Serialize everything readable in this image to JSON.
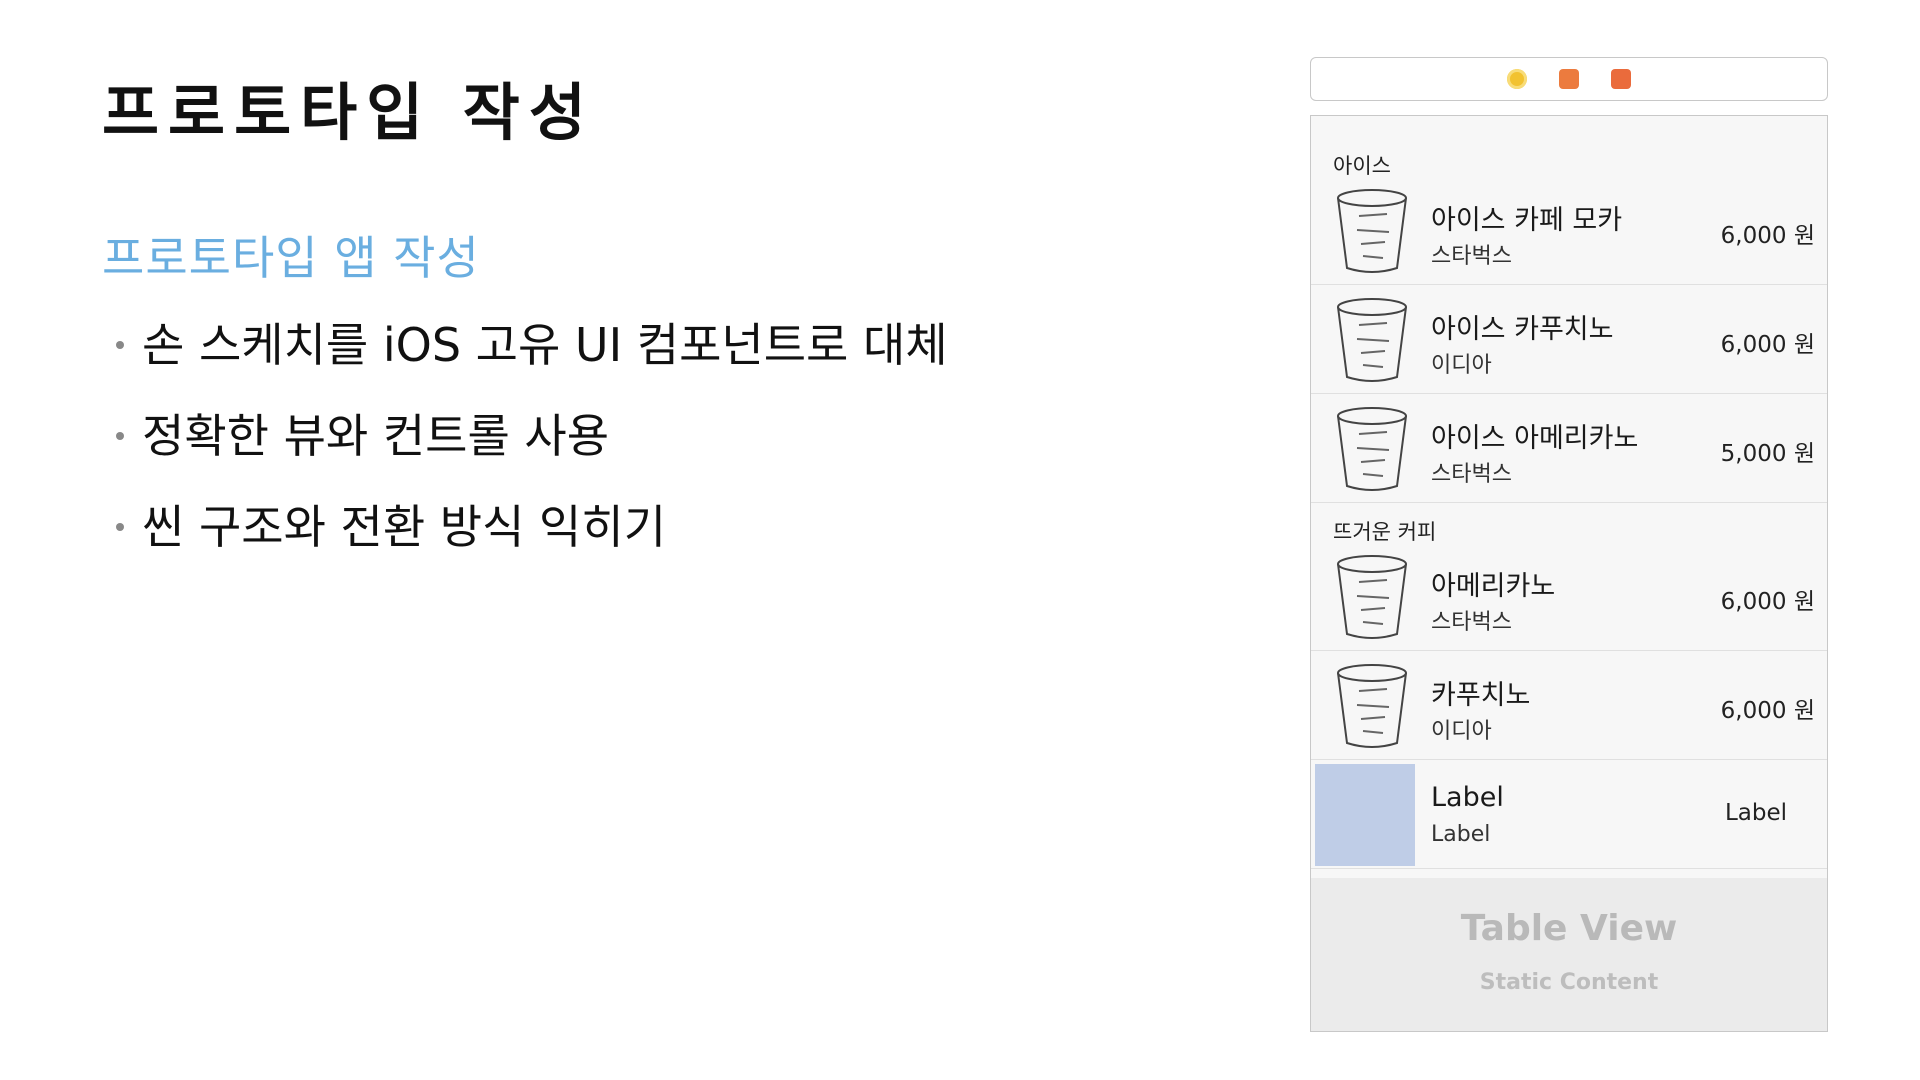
{
  "slide": {
    "title": "프로토타입 작성",
    "subtitle": "프로토타입 앱 작성",
    "bullets": [
      "손 스케치를 iOS 고유 UI 컴포넌트로 대체",
      "정확한 뷰와 컨트롤 사용",
      "씬 구조와 전환 방식 익히기"
    ]
  },
  "scene_bar": {
    "icons": [
      "view-controller-icon",
      "first-responder-icon",
      "exit-icon"
    ]
  },
  "table": {
    "sections": [
      {
        "header": "아이스",
        "rows": [
          {
            "name": "아이스 카페 모카",
            "brand": "스타벅스",
            "price": "6,000 원"
          },
          {
            "name": "아이스 카푸치노",
            "brand": "이디아",
            "price": "6,000 원"
          },
          {
            "name": "아이스 아메리카노",
            "brand": "스타벅스",
            "price": "5,000 원"
          }
        ]
      },
      {
        "header": "뜨거운 커피",
        "rows": [
          {
            "name": "아메리카노",
            "brand": "스타벅스",
            "price": "6,000 원"
          },
          {
            "name": "카푸치노",
            "brand": "이디아",
            "price": "6,000 원"
          }
        ]
      }
    ],
    "prototype_cell": {
      "title": "Label",
      "subtitle": "Label",
      "detail": "Label"
    },
    "footer": {
      "title": "Table View",
      "subtitle": "Static Content"
    }
  }
}
